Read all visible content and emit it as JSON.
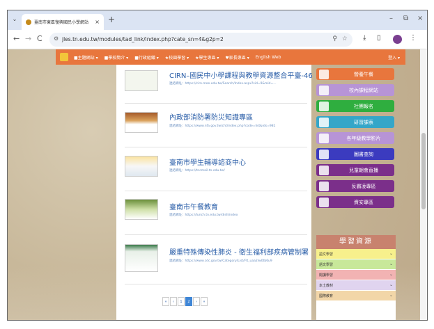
{
  "browser": {
    "tab_title": "臺南市東區復興國民小學網站",
    "tab_close": "×",
    "new_tab": "+",
    "menu_glyph": "⌄",
    "window_controls": [
      "–",
      "⧉",
      "×"
    ],
    "url": "jles.tn.edu.tw/modules/tad_link/index.php?cate_sn=4&g2p=2"
  },
  "navbar": {
    "items": [
      "■主題網站 ▾",
      "■學校簡介 ▾",
      "■行政組織 ▾",
      "★校園學習 ▾",
      "★學生專區 ▾",
      "♥家長專區 ▾",
      "English Web"
    ],
    "login": "登入 ▾"
  },
  "links": [
    {
      "title": "CIRN–國民中小學課程與教學資源整合平臺-46",
      "url": "連結網址：https://cirn.moe.edu.tw/Search/Index.aspx?sid=9&mid=..."
    },
    {
      "title": "內政部消防署防災知識專區",
      "url": "連結網址：https://www.nfa.gov.tw/cht/index.php?code=list&ids=981"
    },
    {
      "title": "臺南市學生輔導諮商中心",
      "url": "連結網址：https://tncmail.tn.edu.tw/"
    },
    {
      "title": "臺南市午餐教育",
      "url": "連結網址：https://lunch.tn.edu.tw/dish/index"
    },
    {
      "title": "嚴重特殊傳染性肺炎 - 衛生福利部疾病管制署",
      "url": "連結網址：https://www.cdc.gov.tw/Category/List/Flt_uaa2lw0tb6u9"
    }
  ],
  "pager": [
    "«",
    "‹",
    "1",
    "2",
    "›",
    "»"
  ],
  "sidebar": {
    "buttons": [
      {
        "label": "營養午餐",
        "color": "#e8763d"
      },
      {
        "label": "校內課程網站",
        "color": "#b794d6"
      },
      {
        "label": "社團報名",
        "color": "#2fae3f"
      },
      {
        "label": "研習課表",
        "color": "#35a6c8"
      },
      {
        "label": "各年級教學影片",
        "color": "#b794d6"
      },
      {
        "label": "圖書查詢",
        "color": "#3b3bbf"
      },
      {
        "label": "兒童朝會直播",
        "color": "#7b2f8a"
      },
      {
        "label": "反霸凌專區",
        "color": "#7b2f8a"
      },
      {
        "label": "資安專區",
        "color": "#7b2f8a"
      }
    ],
    "learn_title": "學習資源",
    "learn_items": [
      {
        "label": "語文學習",
        "color": "#f7f08c"
      },
      {
        "label": "語文學習",
        "color": "#c8e89a"
      },
      {
        "label": "閱讀學習",
        "color": "#f2b3b3"
      },
      {
        "label": "本土教材",
        "color": "#e0d4ef"
      },
      {
        "label": "國際教育",
        "color": "#f2d6a8"
      }
    ]
  }
}
